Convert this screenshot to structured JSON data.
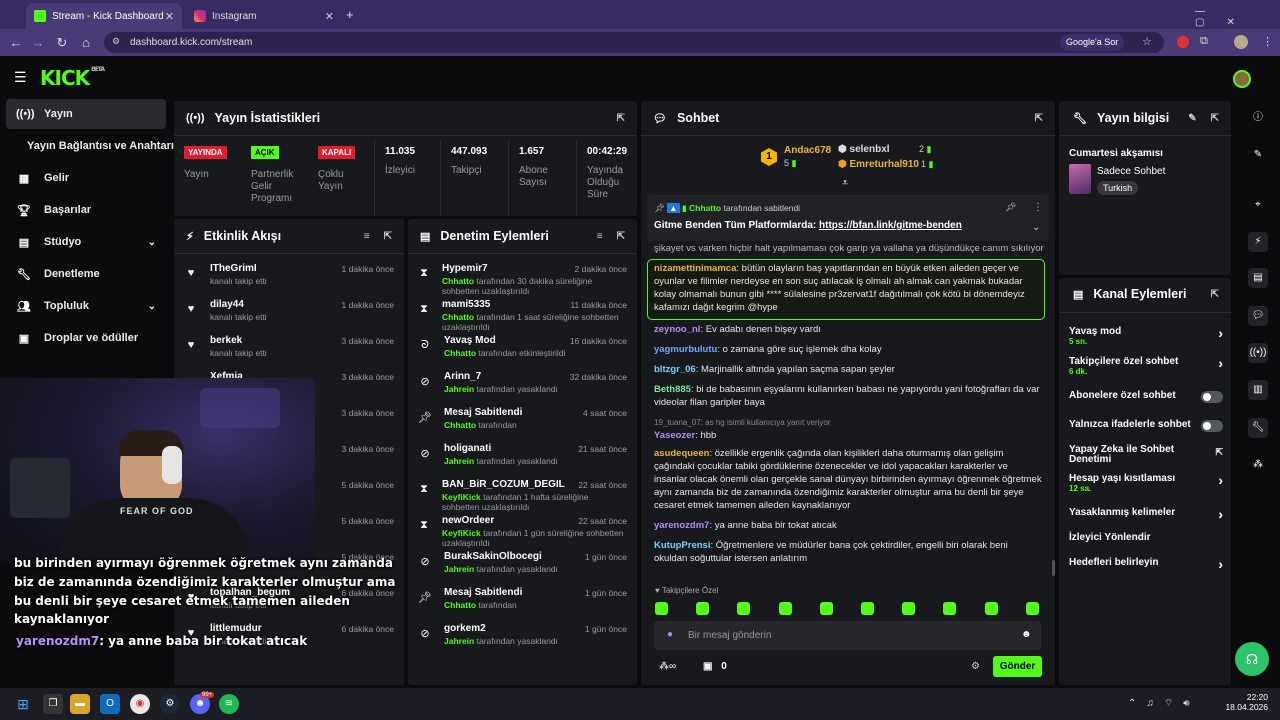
{
  "browser": {
    "tabs": [
      {
        "title": "Stream - Kick Dashboard"
      },
      {
        "title": "Instagram"
      }
    ],
    "url": "dashboard.kick.com/stream",
    "google_btn": "Google'a Sor"
  },
  "brand": {
    "logo": "KICK",
    "beta": "BETA"
  },
  "sidebar": {
    "items": [
      {
        "label": "Yayın",
        "icon": "broadcast-icon"
      },
      {
        "label": "Yayın Bağlantısı ve Anahtarı"
      },
      {
        "label": "Gelir",
        "icon": "grid-icon"
      },
      {
        "label": "Başarılar",
        "icon": "trophy-icon"
      },
      {
        "label": "Stüdyo",
        "icon": "studio-icon"
      },
      {
        "label": "Denetleme",
        "icon": "wrench-icon"
      },
      {
        "label": "Topluluk",
        "icon": "people-icon"
      },
      {
        "label": "Droplar ve ödüller",
        "icon": "gift-icon"
      }
    ]
  },
  "stats": {
    "title": "Yayın İstatistikleri",
    "cells": [
      {
        "badge": "YAYINDA",
        "label": "Yayın"
      },
      {
        "badge": "AÇIK",
        "label": "Partnerlik Gelir Programı"
      },
      {
        "badge": "KAPALI",
        "label": "Çoklu Yayın"
      },
      {
        "value": "11.035",
        "label": "İzleyici"
      },
      {
        "value": "447.093",
        "label": "Takipçi"
      },
      {
        "value": "1.657",
        "label": "Abone Sayısı"
      },
      {
        "value": "00:42:29",
        "label": "Yayında Olduğu Süre"
      }
    ]
  },
  "activity": {
    "title": "Etkinlik Akışı",
    "items": [
      {
        "name": "ITheGrimI",
        "desc": "kanalı takip etti",
        "time": "1 dakika önce"
      },
      {
        "name": "dilay44",
        "desc": "kanalı takip etti",
        "time": "1 dakika önce"
      },
      {
        "name": "berkek",
        "desc": "kanalı takip etti",
        "time": "3 dakika önce"
      },
      {
        "name": "Xefmia",
        "desc": "kanalı takip etti",
        "time": "3 dakika önce"
      },
      {
        "name": "",
        "desc": "",
        "time": "3 dakika önce"
      },
      {
        "name": "",
        "desc": "",
        "time": "3 dakika önce"
      },
      {
        "name": "",
        "desc": "",
        "time": "5 dakika önce"
      },
      {
        "name": "",
        "desc": "kanalı takip etti",
        "time": "5 dakika önce"
      },
      {
        "name": "Gloriouseagle",
        "desc": "",
        "time": "5 dakika önce"
      },
      {
        "name": "topalhan_begum",
        "desc": "kanalı takip etti",
        "time": "6 dakika önce"
      },
      {
        "name": "littlemudur",
        "desc": "kanalı takip etti",
        "time": "6 dakika önce"
      }
    ]
  },
  "moderation": {
    "title": "Denetim Eylemleri",
    "items": [
      {
        "name": "Hypemir7",
        "mod": "Chhatto",
        "desc": "tarafından 30 dakika süreliğine sohbetten uzaklaştırıldı",
        "time": "2 dakika önce",
        "icon": "hourglass-icon"
      },
      {
        "name": "mami5335",
        "mod": "Chhatto",
        "desc": "tarafından 1 saat süreliğine sohbetten uzaklaştırıldı",
        "time": "11 dakika önce",
        "icon": "hourglass-icon"
      },
      {
        "name": "Yavaş Mod",
        "mod": "Chhatto",
        "desc": "tarafından etkinleştirildi",
        "time": "16 dakika önce",
        "icon": "snail-icon"
      },
      {
        "name": "Arinn_7",
        "mod": "Jahrein",
        "desc": "tarafından yasaklandı",
        "time": "32 dakika önce",
        "icon": "ban-icon"
      },
      {
        "name": "Mesaj Sabitlendi",
        "mod": "Chhatto",
        "desc": "tarafından",
        "time": "4 saat önce",
        "icon": "pin-icon"
      },
      {
        "name": "holiganati",
        "mod": "Jahrein",
        "desc": "tarafından yasaklandı",
        "time": "21 saat önce",
        "icon": "ban-icon"
      },
      {
        "name": "BAN_BiR_COZUM_DEGIL",
        "mod": "KeyfiKick",
        "desc": "tarafından 1 hafta süreliğine sohbetten uzaklaştırıldı",
        "time": "22 saat önce",
        "icon": "hourglass-icon"
      },
      {
        "name": "newOrdeer",
        "mod": "KeyfiKick",
        "desc": "tarafından 1 gün süreliğine sohbetten uzaklaştırıldı",
        "time": "22 saat önce",
        "icon": "hourglass-icon"
      },
      {
        "name": "BurakSakinOlbocegi",
        "mod": "Jahrein",
        "desc": "tarafından yasaklandı",
        "time": "1 gün önce",
        "icon": "ban-icon"
      },
      {
        "name": "Mesaj Sabitlendi",
        "mod": "Chhatto",
        "desc": "tarafından",
        "time": "1 gün önce",
        "icon": "pin-icon"
      },
      {
        "name": "gorkem2",
        "mod": "Jahrein",
        "desc": "tarafından yasaklandı",
        "time": "1 gün önce",
        "icon": "ban-icon"
      }
    ]
  },
  "chat": {
    "title": "Sohbet",
    "leaders": [
      {
        "rank": "1",
        "name": "Andac678",
        "count": "5"
      },
      {
        "name": "selenbxl",
        "count": "2"
      },
      {
        "name": "Emreturhal910",
        "count": "1"
      }
    ],
    "pinned": {
      "by": "Chhatto",
      "by_suffix": "tarafından sabitlendi",
      "text": "Gitme Benden Tüm Platformlarda:",
      "link": "https://bfan.link/gitme-benden"
    },
    "truncated": "şikayet vs varken hiçbir halt yapılmaması çok garip ya vallaha ya düşündükçe canım sıkılıyor",
    "messages": [
      {
        "user": "nizamettinimamca",
        "color": "#e9b544",
        "text": "bütün olayların baş yapıtlarından en büyük etken aileden geçer ve oyunlar ve filimler nerdeyse en son suç atılacak iş olmalı ah almak can yakmak bukadar kolay olmamalı bunun gibi **** sülalesine pr3zervat1f dağıtılmalı çok kötü bi dönemdeyiz kafamızı dağıt kegrim @hype"
      },
      {
        "user": "zeynoo_nl",
        "color": "#b38ef3",
        "text": "Ev adabı denen bişey vardı"
      },
      {
        "user": "yagmurbulutu",
        "color": "#6fa8ff",
        "text": "o zamana göre suç işlemek dha kolay"
      },
      {
        "user": "bltzgr_06",
        "color": "#6fd6ff",
        "text": "Marjinallik altında yapılan saçma sapan şeyler"
      },
      {
        "user": "Beth885",
        "color": "#7ee0a1",
        "text": "bi de babasının eşyalarını kullanırken babası ne yapıyordu yani fotoğrafları da var videolar filan garipler baya"
      },
      {
        "reply": "19_tuana_07: as hg isimli kullanıcıya yanıt veriyor",
        "user": "Yaseozer",
        "color": "#b38ef3",
        "text": "hbb"
      },
      {
        "user": "asudequeen",
        "color": "#e9b544",
        "text": "özellikle ergenlik çağında olan kişilikleri daha oturmamış olan gelişim çağındaki çocuklar tabiki gördüklerine özenecekler ve idol yapacakları karakterler ve insanlar olacak önemli olan gerçekle sanal dünyayı birbirinden ayırmayı öğrenmek öğretmek aynı zamanda biz de zamanında özendiğimiz karakterler olmuştur ama bu denli bir şeye cesaret etmek tamemen aileden kaynaklanıyor"
      },
      {
        "user": "yarenozdm7",
        "color": "#b38ef3",
        "text": "ya anne baba bir tokat atıcak"
      },
      {
        "user": "KutupPrensi",
        "color": "#6fd6ff",
        "text": "Öğretmenlere ve müdürler bana çok çektirdiler, engelli biri olarak beni okuldan soğuttular istersen anlatırım"
      }
    ],
    "followers_only": "Takipçilere Özel",
    "placeholder": "Bir mesaj gönderin",
    "send": "Gönder",
    "points": "0"
  },
  "stream_info": {
    "title": "Yayın bilgisi",
    "stream_title": "Cumartesi akşamısı",
    "category": "Sadece Sohbet",
    "tag": "Turkish"
  },
  "channel_actions": {
    "title": "Kanal Eylemleri",
    "items": [
      {
        "label": "Yavaş mod",
        "value": "5 sn.",
        "type": "chev"
      },
      {
        "label": "Takipçilere özel sohbet",
        "value": "6 dk.",
        "type": "chev"
      },
      {
        "label": "Abonelere özel sohbet",
        "type": "toggle"
      },
      {
        "label": "Yalnızca ifadelerle sohbet",
        "type": "toggle"
      },
      {
        "label": "Yapay Zeka ile Sohbet Denetimi",
        "type": "ext"
      },
      {
        "label": "Hesap yaşı kısıtlaması",
        "value": "12 sa.",
        "type": "chev"
      },
      {
        "label": "Yasaklanmış kelimeler",
        "type": "chev"
      },
      {
        "label": "İzleyici Yönlendir",
        "type": "none"
      },
      {
        "label": "Hedefleri belirleyin",
        "type": "chev"
      }
    ]
  },
  "overlay": {
    "lines": [
      "bu birinden ayırmayı öğrenmek öğretmek aynı zamanda",
      "biz de zamanında özendiğimiz karakterler olmuştur ama",
      "bu denli bir şeye cesaret etmek tamemen aileden",
      "kaynaklanıyor"
    ],
    "user": "yarenozdm7",
    "msg": ": ya anne baba bir tokat atıcak",
    "hoodie": "FEAR OF GOD"
  },
  "taskbar": {
    "time": "22:20",
    "date": "18.04.2026",
    "badge": "99+"
  },
  "colors": {
    "kick_green": "#53fc18",
    "panel": "#18191c",
    "bg": "#0b0b0d"
  }
}
